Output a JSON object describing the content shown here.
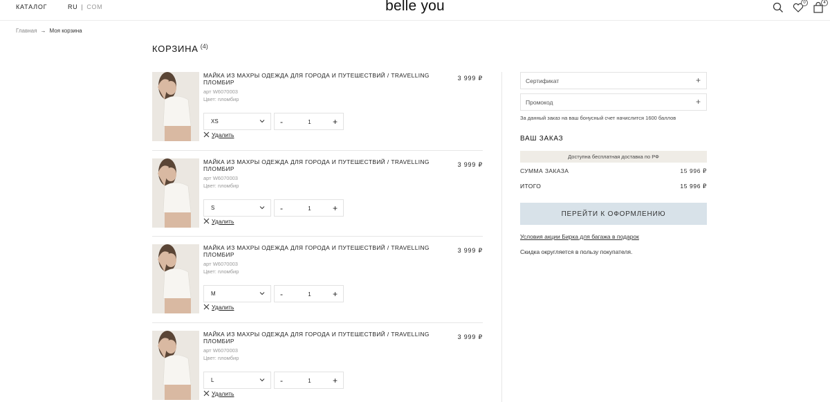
{
  "header": {
    "catalog_label": "КАТАЛОГ",
    "lang_active": "RU",
    "lang_separator": "|",
    "lang_inactive": "COM",
    "logo": "belle you",
    "favorites_count": "0",
    "cart_count": "4"
  },
  "breadcrumb": {
    "home": "Главная",
    "arrow": "→",
    "current": "Моя корзина"
  },
  "cart": {
    "title": "КОРЗИНА",
    "count": "(4)"
  },
  "items": [
    {
      "name": "МАЙКА ИЗ МАХРЫ ОДЕЖДА ДЛЯ ГОРОДА И ПУТЕШЕСТВИЙ / TRAVELLING ПЛОМБИР",
      "article": "арт W6070003",
      "color": "Цвет: пломбир",
      "price": "3 999 ₽",
      "size": "XS",
      "qty": "1",
      "minus": "-",
      "plus": "+",
      "remove": "Удалить"
    },
    {
      "name": "МАЙКА ИЗ МАХРЫ ОДЕЖДА ДЛЯ ГОРОДА И ПУТЕШЕСТВИЙ / TRAVELLING ПЛОМБИР",
      "article": "арт W6070003",
      "color": "Цвет: пломбир",
      "price": "3 999 ₽",
      "size": "S",
      "qty": "1",
      "minus": "-",
      "plus": "+",
      "remove": "Удалить"
    },
    {
      "name": "МАЙКА ИЗ МАХРЫ ОДЕЖДА ДЛЯ ГОРОДА И ПУТЕШЕСТВИЙ / TRAVELLING ПЛОМБИР",
      "article": "арт W6070003",
      "color": "Цвет: пломбир",
      "price": "3 999 ₽",
      "size": "M",
      "qty": "1",
      "minus": "-",
      "plus": "+",
      "remove": "Удалить"
    },
    {
      "name": "МАЙКА ИЗ МАХРЫ ОДЕЖДА ДЛЯ ГОРОДА И ПУТЕШЕСТВИЙ / TRAVELLING ПЛОМБИР",
      "article": "арт W6070003",
      "color": "Цвет: пломбир",
      "price": "3 999 ₽",
      "size": "L",
      "qty": "1",
      "minus": "-",
      "plus": "+",
      "remove": "Удалить"
    }
  ],
  "sidebar": {
    "certificate_label": "Сертификат",
    "promocode_label": "Промокод",
    "field_plus": "+",
    "bonus_note": "За данный заказ на ваш бонусный счет начислится 1600 баллов",
    "order_title": "ВАШ ЗАКАЗ",
    "delivery_banner": "Доступна бесплатная доставка по РФ",
    "sum_label": "СУММА ЗАКАЗА",
    "sum_value": "15 996 ₽",
    "total_label": "ИТОГО",
    "total_value": "15 996 ₽",
    "checkout_label": "ПЕРЕЙТИ К ОФОРМЛЕНИЮ",
    "promo_link": "Условия акции Бирка для багажа в подарок",
    "rounding_note": "Скидка округляется в пользу покупателя."
  },
  "colors": {
    "checkout_button_bg": "#d8e2e9",
    "delivery_banner_bg": "#efece6",
    "divider": "#e6e6e6"
  },
  "icons": {
    "search": "search-icon",
    "favorites": "heart-icon",
    "cart": "bag-icon",
    "remove": "close-icon",
    "size_select": "chevron-down-icon"
  }
}
